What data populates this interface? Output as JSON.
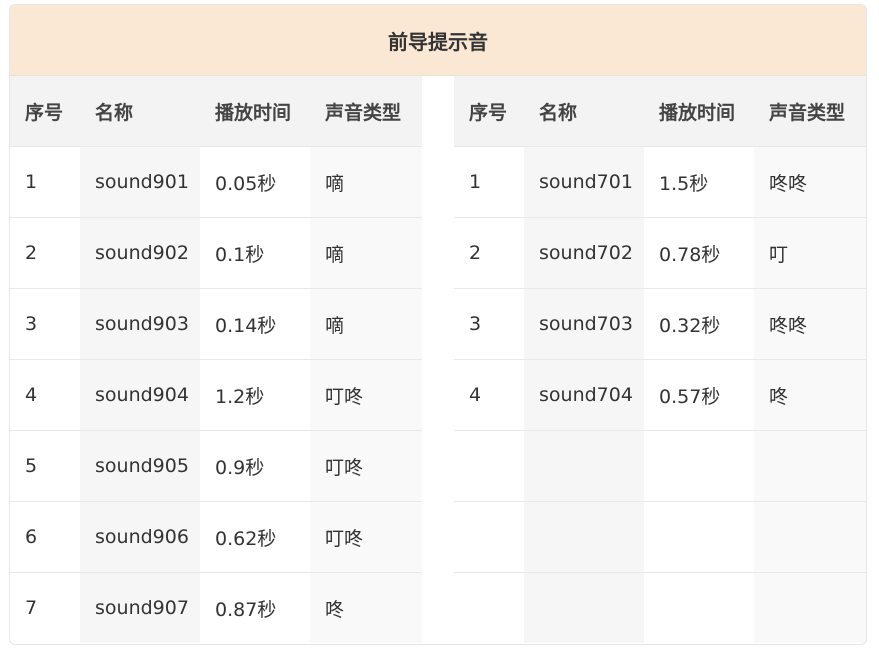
{
  "title": "前导提示音",
  "headers": [
    "序号",
    "名称",
    "播放时间",
    "声音类型"
  ],
  "left_rows": [
    [
      "1",
      "sound901",
      "0.05秒",
      "嘀"
    ],
    [
      "2",
      "sound902",
      "0.1秒",
      "嘀"
    ],
    [
      "3",
      "sound903",
      "0.14秒",
      "嘀"
    ],
    [
      "4",
      "sound904",
      "1.2秒",
      "叮咚"
    ],
    [
      "5",
      "sound905",
      "0.9秒",
      "叮咚"
    ],
    [
      "6",
      "sound906",
      "0.62秒",
      "叮咚"
    ],
    [
      "7",
      "sound907",
      "0.87秒",
      "咚"
    ]
  ],
  "right_rows": [
    [
      "1",
      "sound701",
      "1.5秒",
      "咚咚"
    ],
    [
      "2",
      "sound702",
      "0.78秒",
      "叮"
    ],
    [
      "3",
      "sound703",
      "0.32秒",
      "咚咚"
    ],
    [
      "4",
      "sound704",
      "0.57秒",
      "咚"
    ],
    [
      "",
      "",
      "",
      ""
    ],
    [
      "",
      "",
      "",
      ""
    ],
    [
      "",
      "",
      "",
      ""
    ]
  ]
}
